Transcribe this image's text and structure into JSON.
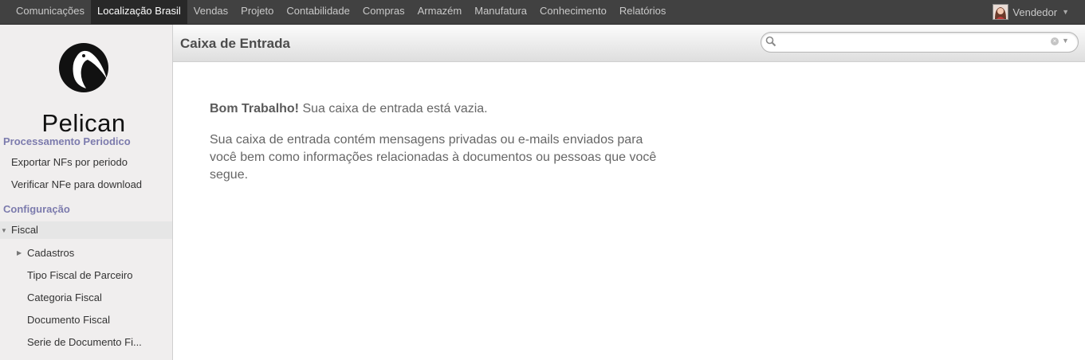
{
  "topnav": {
    "items": [
      "Comunicações",
      "Localização Brasil",
      "Vendas",
      "Projeto",
      "Contabilidade",
      "Compras",
      "Armazém",
      "Manufatura",
      "Conhecimento",
      "Relatórios"
    ],
    "active": "Localização Brasil"
  },
  "user": {
    "name": "Vendedor",
    "icon": "avatar-icon"
  },
  "sidebar": {
    "logo_text": "Pelican",
    "section1": "Processamento Periodico",
    "section1_items": [
      "Exportar NFs por periodo",
      "Verificar NFe para download"
    ],
    "section2": "Configuração",
    "fiscal": "Fiscal",
    "fiscal_items": [
      "Cadastros",
      "Tipo Fiscal de Parceiro",
      "Categoria Fiscal",
      "Documento Fiscal",
      "Serie de Documento Fi..."
    ]
  },
  "header": {
    "title": "Caixa de Entrada",
    "search_value": ""
  },
  "main": {
    "bold": "Bom Trabalho!",
    "line1": " Sua caixa de entrada está vazia.",
    "para2": "Sua caixa de entrada contém mensagens privadas ou e-mails enviados para você bem como informações relacionadas à documentos ou pessoas que você segue."
  }
}
